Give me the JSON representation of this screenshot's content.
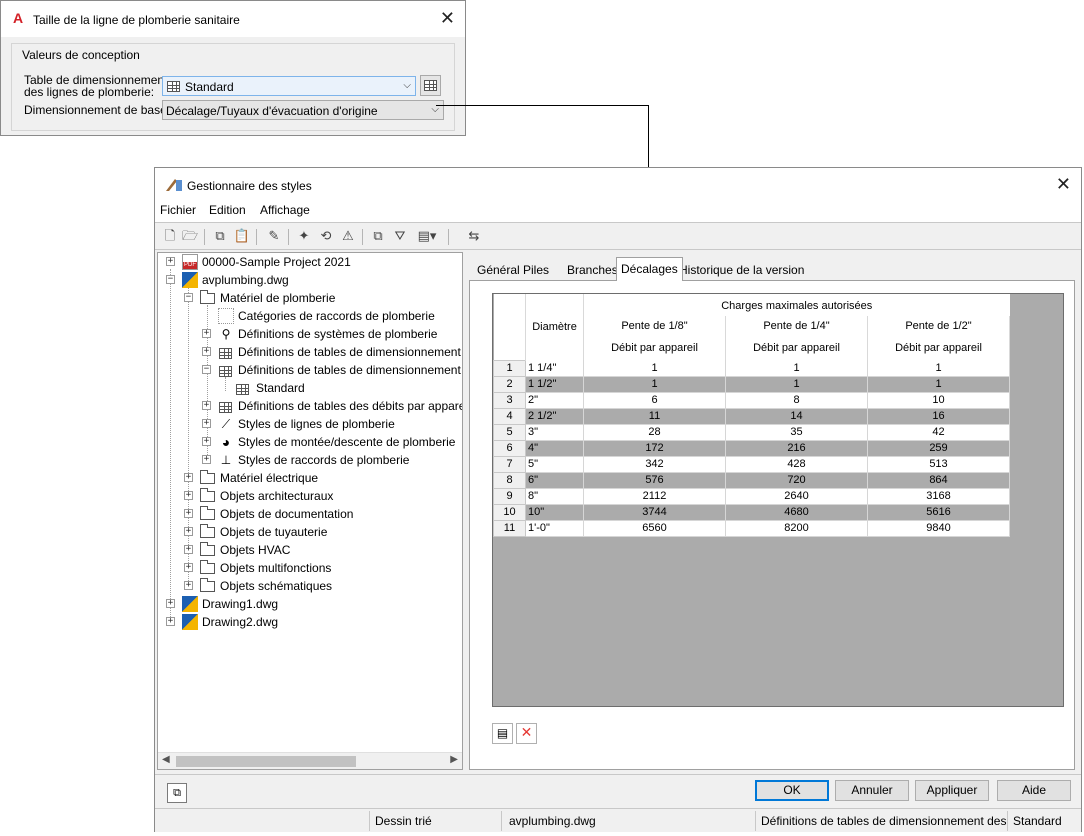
{
  "dialog_size": {
    "title": "Taille de la ligne de plomberie sanitaire",
    "group_title": "Valeurs de conception",
    "table_label_line1": "Table de dimensionnement",
    "table_label_line2": "des lignes de plomberie:",
    "table_value": "Standard",
    "base_label": "Dimensionnement de base:",
    "base_value": "Décalage/Tuyaux d'évacuation d'origine"
  },
  "style_manager": {
    "title": "Gestionnaire des styles",
    "menu": [
      "Fichier",
      "Edition",
      "Affichage"
    ],
    "tree": {
      "project": "00000-Sample Project 2021",
      "file1": "avplumbing.dwg",
      "plumbing_material": "Matériel de plomberie",
      "cat_fittings": "Catégories de raccords de plomberie",
      "sys_defs": "Définitions de systèmes de plomberie",
      "sizing_defs_1": "Définitions de tables de dimensionnement",
      "sizing_defs_2": "Définitions de tables de dimensionnement",
      "standard": "Standard",
      "flow_defs": "Définitions de tables des débits par appare",
      "line_styles": "Styles de lignes de plomberie",
      "riser_styles": "Styles de montée/descente de plomberie",
      "fitting_styles": "Styles de raccords de plomberie",
      "electrical": "Matériel électrique",
      "architectural": "Objets architecturaux",
      "documentation": "Objets de documentation",
      "piping": "Objets de tuyauterie",
      "hvac": "Objets HVAC",
      "multipurpose": "Objets multifonctions",
      "schematic": "Objets schématiques",
      "file2": "Drawing1.dwg",
      "file3": "Drawing2.dwg"
    },
    "tabs": [
      "Général",
      "Piles",
      "Branches",
      "Décalages",
      "Historique de la version"
    ],
    "active_tab": "Décalages",
    "grid": {
      "group_header": "Charges maximales autorisées",
      "diameter_header": "Diamètre",
      "slope_headers": [
        "Pente de 1/8\"",
        "Pente de 1/4\"",
        "Pente de 1/2\""
      ],
      "sub_header": "Débit par appareil",
      "rows": [
        [
          "1",
          "1 1/4\"",
          "1",
          "1",
          "1"
        ],
        [
          "2",
          "1 1/2\"",
          "1",
          "1",
          "1"
        ],
        [
          "3",
          "2\"",
          "6",
          "8",
          "10"
        ],
        [
          "4",
          "2 1/2\"",
          "11",
          "14",
          "16"
        ],
        [
          "5",
          "3\"",
          "28",
          "35",
          "42"
        ],
        [
          "6",
          "4\"",
          "172",
          "216",
          "259"
        ],
        [
          "7",
          "5\"",
          "342",
          "428",
          "513"
        ],
        [
          "8",
          "6\"",
          "576",
          "720",
          "864"
        ],
        [
          "9",
          "8\"",
          "2112",
          "2640",
          "3168"
        ],
        [
          "10",
          "10\"",
          "3744",
          "4680",
          "5616"
        ],
        [
          "11",
          "1'-0\"",
          "6560",
          "8200",
          "9840"
        ]
      ]
    },
    "buttons": {
      "ok": "OK",
      "cancel": "Annuler",
      "apply": "Appliquer",
      "help": "Aide"
    },
    "status": {
      "sort": "Dessin trié",
      "file": "avplumbing.dwg",
      "type": "Définitions de tables de dimensionnement des",
      "style": "Standard"
    }
  },
  "colors": {
    "accent": "#0078d7",
    "app_icon": "#d32027",
    "delete": "#e53935"
  }
}
